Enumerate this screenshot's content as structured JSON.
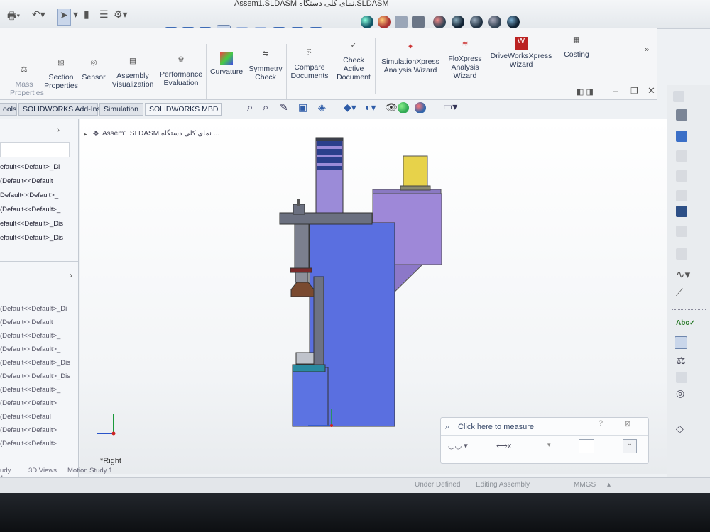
{
  "window": {
    "title": "Assem1.SLDASM نمای کلی دستگاه.SLDASM"
  },
  "ribbon": {
    "items": [
      {
        "label": "Mass\nProperties"
      },
      {
        "label": "Section\nProperties"
      },
      {
        "label": "Sensor"
      },
      {
        "label": "Assembly\nVisualization"
      },
      {
        "label": "Performance\nEvaluation"
      },
      {
        "label": "Curvature"
      },
      {
        "label": "Symmetry\nCheck"
      },
      {
        "label": "Compare\nDocuments"
      },
      {
        "label": "Check\nActive\nDocument"
      },
      {
        "label": "SimulationXpress\nAnalysis Wizard"
      },
      {
        "label": "FloXpress\nAnalysis\nWizard"
      },
      {
        "label": "DriveWorksXpress\nWizard"
      },
      {
        "label": "Costing"
      }
    ],
    "overflow": "»"
  },
  "tabs": [
    "ools",
    "SOLIDWORKS Add-Ins",
    "Simulation",
    "SOLIDWORKS MBD"
  ],
  "tree": {
    "breadcrumb": "Assem1.SLDASM نمای کلی دستگاه ...",
    "group1": [
      "efault<<Default>_Di",
      "(Default<<Default",
      "Default<<Default>_",
      "(Default<<Default>_",
      "efault<<Default>_Dis",
      "efault<<Default>_Dis"
    ],
    "group2": [
      "(Default<<Default>_Di",
      "(Default<<Default",
      "(Default<<Default>_",
      "(Default<<Default>_",
      "(Default<<Default>_Dis",
      "(Default<<Default>_Dis",
      "(Default<<Default>_",
      "(Default<<Default>",
      "(Default<<Defaul",
      "(Default<<Default>",
      "(Default<<Default>"
    ]
  },
  "viewport": {
    "view_label": "*Right"
  },
  "measure": {
    "title": "Click here to measure"
  },
  "bottom_tabs": [
    "udy 1",
    "3D Views",
    "Motion Study 1"
  ],
  "status": {
    "state": "Under Defined",
    "mode": "Editing Assembly",
    "units": "MMGS"
  },
  "colors": {
    "part_blue": "#5870e0",
    "part_purple": "#9a86d6",
    "cap_yellow": "#e8d34a",
    "accent": "#2f6fc9"
  }
}
